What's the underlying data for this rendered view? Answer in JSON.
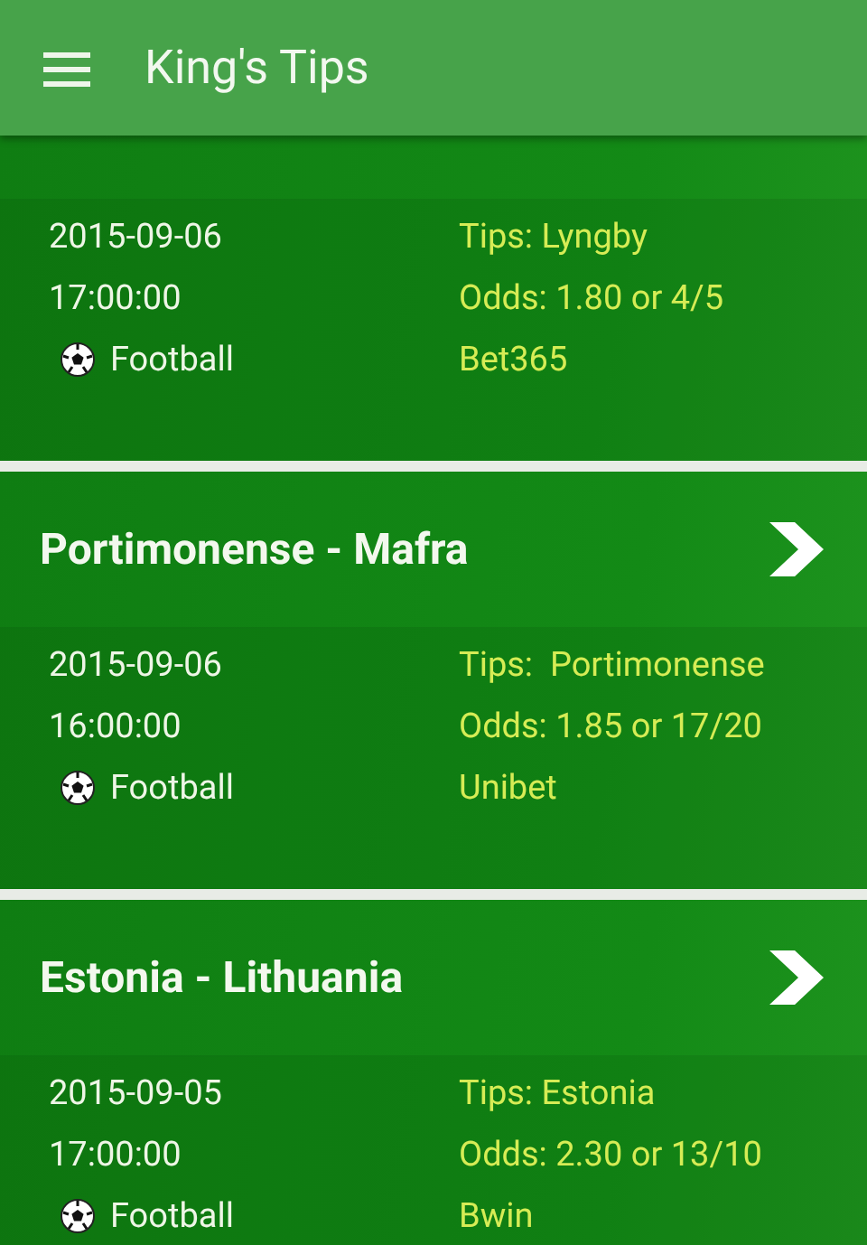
{
  "app_bar": {
    "title": "King's Tips"
  },
  "matches": [
    {
      "date": "2015-09-06",
      "time": "17:00:00",
      "sport": "Football",
      "tip": "Tips: Lyngby",
      "odds": "Odds: 1.80 or 4/5",
      "bookmaker": "Bet365"
    },
    {
      "title": "Portimonense - Mafra",
      "date": "2015-09-06",
      "time": "16:00:00",
      "sport": "Football",
      "tip": "Tips:  Portimonense",
      "odds": "Odds: 1.85 or 17/20",
      "bookmaker": "Unibet"
    },
    {
      "title": "Estonia - Lithuania",
      "date": "2015-09-05",
      "time": "17:00:00",
      "sport": "Football",
      "tip": "Tips: Estonia",
      "odds": "Odds: 2.30 or 13/10",
      "bookmaker": "Bwin"
    }
  ]
}
